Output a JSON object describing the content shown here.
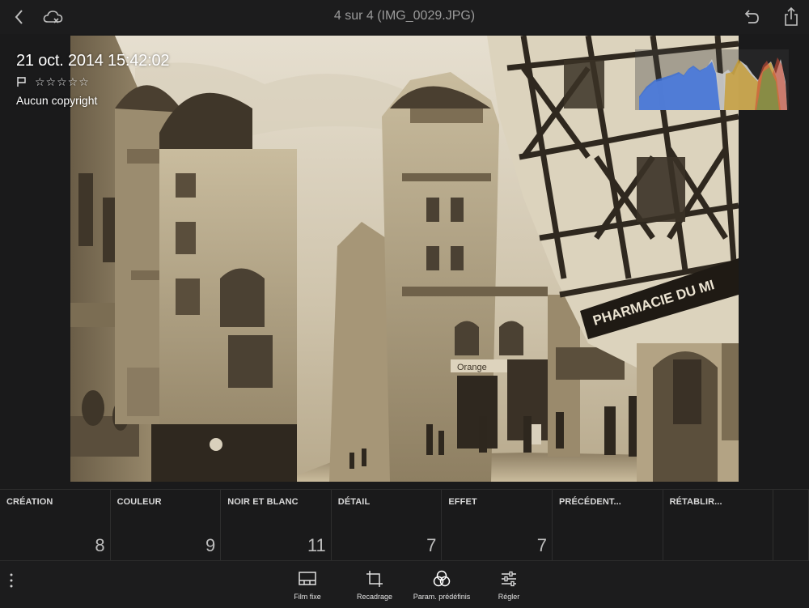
{
  "topbar": {
    "title": "4 sur 4 (IMG_0029.JPG)",
    "back_icon": "chevron-left-icon",
    "cloud_icon": "cloud-off-icon",
    "undo_icon": "undo-icon",
    "share_icon": "share-icon"
  },
  "photo_info": {
    "date": "21 oct. 2014 15:42:02",
    "stars": "☆☆☆☆☆",
    "rating": 0,
    "copyright": "Aucun copyright"
  },
  "photo": {
    "pharmacy_sign": "PHARMACIE DU MI",
    "shop_sign": "Orange"
  },
  "presets": [
    {
      "label": "CRÉATION",
      "count": "8"
    },
    {
      "label": "COULEUR",
      "count": "9"
    },
    {
      "label": "NOIR ET BLANC",
      "count": "11"
    },
    {
      "label": "DÉTAIL",
      "count": "7"
    },
    {
      "label": "EFFET",
      "count": "7"
    },
    {
      "label": "PRÉCÉDENT...",
      "count": ""
    },
    {
      "label": "RÉTABLIR...",
      "count": ""
    }
  ],
  "toolbar": {
    "items": [
      {
        "label": "Film fixe",
        "icon": "filmstrip-icon"
      },
      {
        "label": "Recadrage",
        "icon": "crop-icon"
      },
      {
        "label": "Param. prédéfinis",
        "icon": "presets-icon"
      },
      {
        "label": "Régler",
        "icon": "sliders-icon"
      }
    ]
  },
  "colors": {
    "background": "#1a1a1b",
    "panel_border": "#2e2e2e",
    "text": "#e6e6e6",
    "muted_text": "#9a9a9a"
  }
}
